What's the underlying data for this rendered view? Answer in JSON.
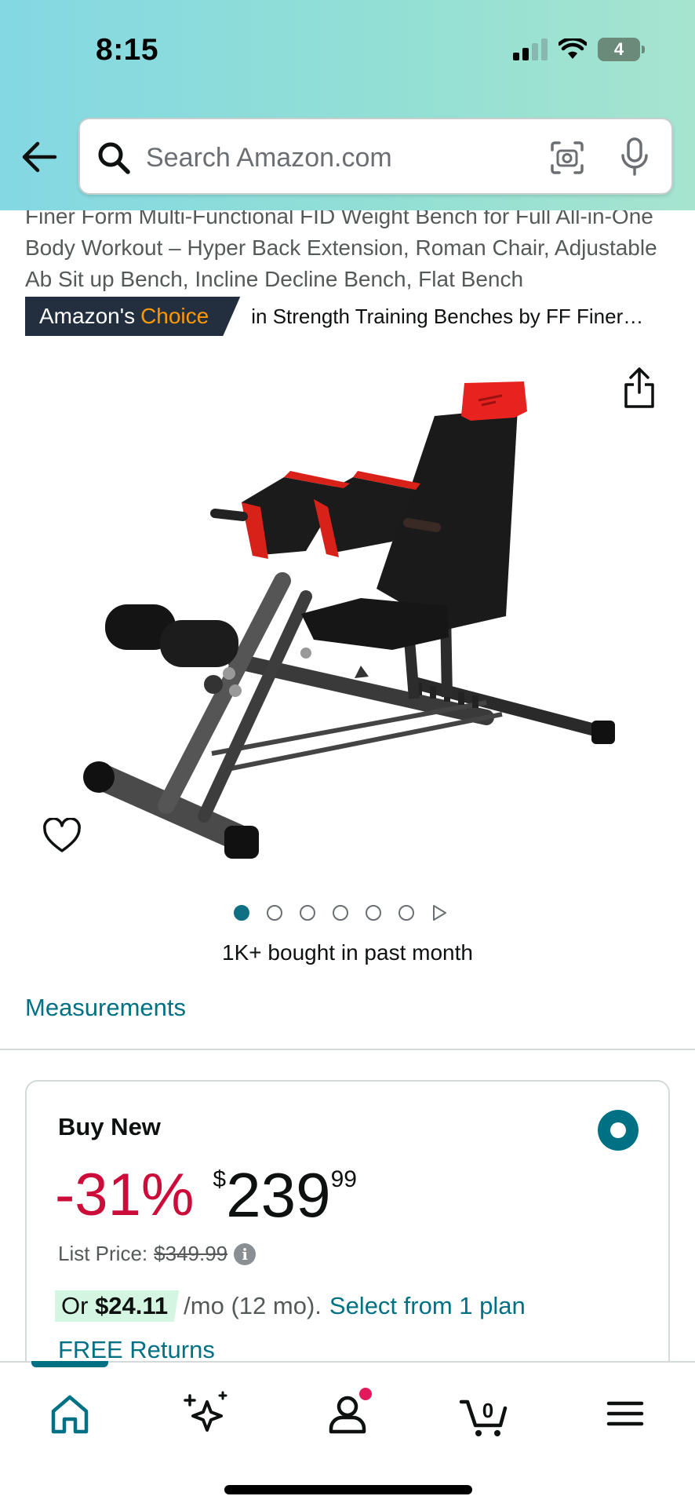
{
  "status_bar": {
    "time": "8:15",
    "battery": "4",
    "icons": [
      "signal-icon",
      "wifi-icon",
      "battery-icon"
    ]
  },
  "search": {
    "placeholder": "Search Amazon.com",
    "icons": [
      "back-arrow-icon",
      "search-icon",
      "camera-icon",
      "microphone-icon"
    ]
  },
  "product": {
    "title": "Finer Form Multi-Functional FID Weight Bench for Full All-in-One Body Workout – Hyper Back Extension, Roman Chair, Adjustable Ab Sit up Bench, Incline Decline Bench, Flat Bench",
    "badge_prefix": "Amazon's",
    "badge_highlight": "Choice",
    "badge_category": "in Strength Training Benches by FF Finer…",
    "image_count": 6,
    "active_image": 1,
    "bought": "1K+ bought in past month",
    "measurements_link": "Measurements"
  },
  "buy_box": {
    "title": "Buy New",
    "discount": "-31%",
    "currency": "$",
    "price_whole": "239",
    "price_fraction": "99",
    "list_price_label": "List Price:",
    "list_price": "$349.99",
    "installment_prefix": "Or",
    "installment_amount": "$24.11",
    "installment_term": "/mo (12 mo).",
    "installment_link": "Select from 1 plan",
    "returns": "FREE Returns"
  },
  "bottom_nav": {
    "items": [
      "home-icon",
      "rufus-sparkle-icon",
      "account-icon",
      "cart-icon",
      "menu-icon"
    ],
    "cart_count": "0",
    "colors": {
      "active": "#007185",
      "notification": "#e3195b"
    }
  },
  "colors": {
    "link": "#007185",
    "discount": "#cc0c39",
    "badge_bg": "#232f3e",
    "badge_accent": "#ff9900"
  }
}
